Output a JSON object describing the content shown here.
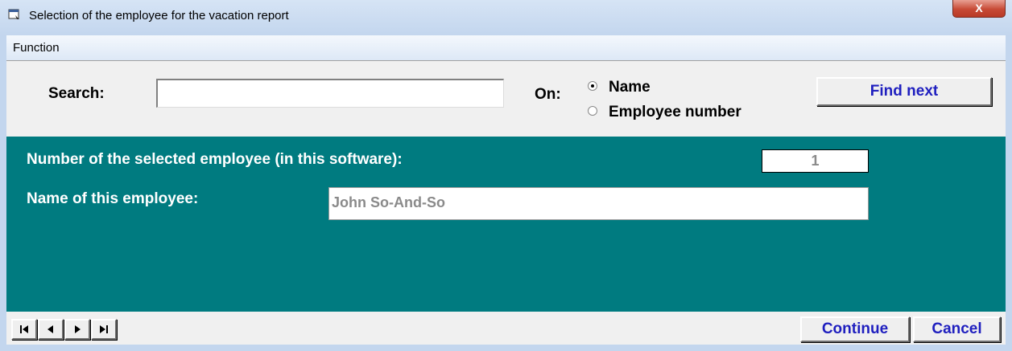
{
  "window": {
    "title": "Selection of the employee for the vacation report",
    "close_label": "X"
  },
  "menu": {
    "items": [
      "Function"
    ]
  },
  "search": {
    "label": "Search:",
    "value": "",
    "on_label": "On:",
    "options": [
      {
        "label": "Name",
        "selected": true
      },
      {
        "label": "Employee number",
        "selected": false
      }
    ],
    "find_next_label": "Find next"
  },
  "employee": {
    "number_label": "Number of the selected employee (in this software):",
    "number_value": "1",
    "name_label": "Name of this employee:",
    "name_value": "John So-And-So"
  },
  "footer": {
    "continue_label": "Continue",
    "cancel_label": "Cancel"
  },
  "colors": {
    "teal_panel": "#007b80",
    "button_text": "#1f1fbf"
  }
}
